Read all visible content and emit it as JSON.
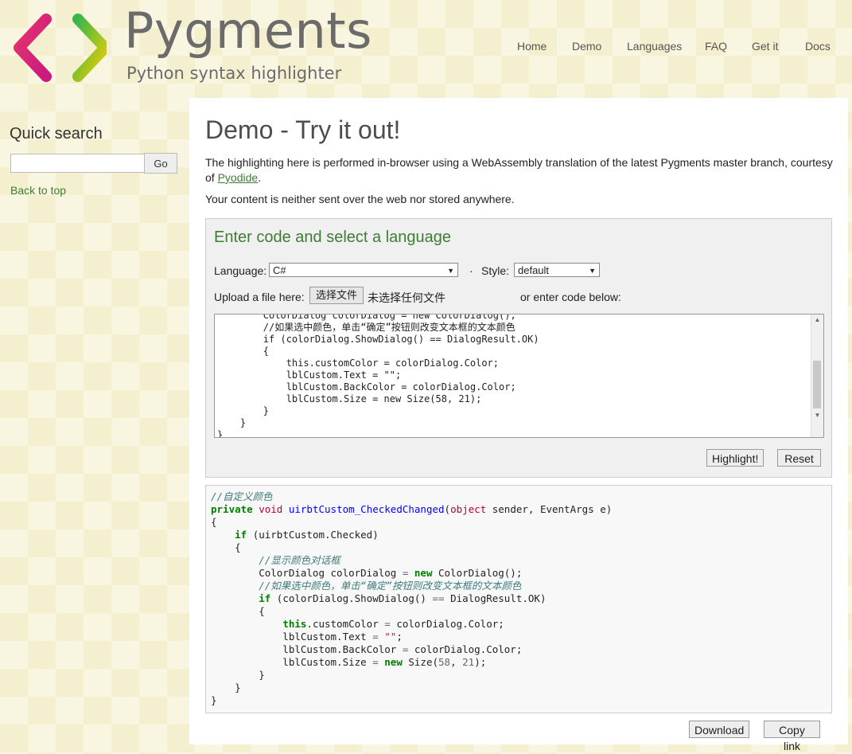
{
  "brand": {
    "name": "Pygments",
    "tagline": "Python syntax highlighter"
  },
  "nav": [
    "Home",
    "Demo",
    "Languages",
    "FAQ",
    "Get it",
    "Docs"
  ],
  "sidebar": {
    "search_title": "Quick search",
    "go_label": "Go",
    "back_to_top": "Back to top"
  },
  "main": {
    "title": "Demo - Try it out!",
    "intro_prefix": "The highlighting here is performed in-browser using a WebAssembly translation of the latest Pygments master branch, courtesy of ",
    "intro_link": "Pyodide",
    "intro_suffix": ".",
    "privacy": "Your content is neither sent over the web nor stored anywhere."
  },
  "form": {
    "title": "Enter code and select a language",
    "language_label": "Language:",
    "language_value": "C#",
    "separator": "·",
    "style_label": "Style:",
    "style_value": "default",
    "upload_label": "Upload a file here:",
    "file_button": "选择文件",
    "file_status": "未选择任何文件",
    "or_enter": "or enter code below:",
    "code_text": "        ColorDialog colorDialog = new ColorDialog();\n        //如果选中颜色，单击“确定”按钮则改变文本框的文本颜色\n        if (colorDialog.ShowDialog() == DialogResult.OK)\n        {\n            this.customColor = colorDialog.Color;\n            lblCustom.Text = \"\";\n            lblCustom.BackColor = colorDialog.Color;\n            lblCustom.Size = new Size(58, 21);\n        }\n    }\n}",
    "highlight_button": "Highlight!",
    "reset_button": "Reset"
  },
  "output": {
    "download_button": "Download",
    "copy_link_button": "Copy link"
  },
  "colors": {
    "accent_green": "#3e7d34",
    "background": "#f4efcf"
  }
}
